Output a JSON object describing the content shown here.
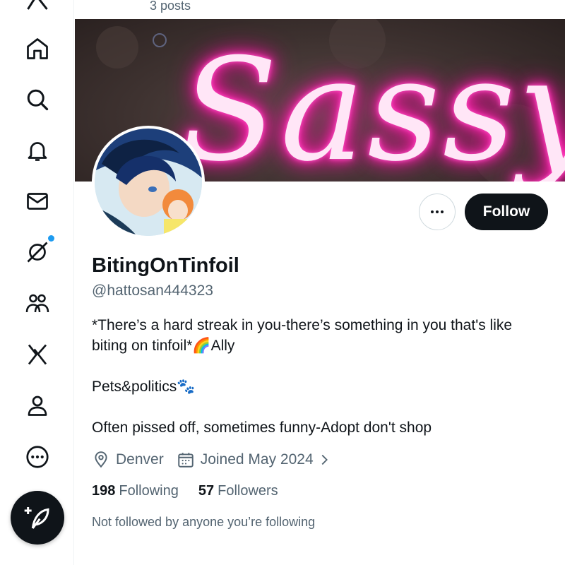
{
  "header": {
    "post_count": "3 posts"
  },
  "profile": {
    "display_name": "BitingOnTinfoil",
    "handle": "@hattosan444323",
    "bio": {
      "line1": "*There’s a hard streak in you-there’s something in you that's like biting on tinfoil*🌈Ally",
      "line2": "Pets&politics🐾",
      "line3": "Often pissed off, sometimes funny-Adopt don't shop"
    },
    "location": "Denver",
    "joined": "Joined May 2024",
    "following_count": "198",
    "following_label": "Following",
    "followers_count": "57",
    "followers_label": "Followers",
    "not_followed_note": "Not followed by anyone you’re following"
  },
  "banner": {
    "text": "Sassy"
  },
  "buttons": {
    "follow": "Follow"
  },
  "sidebar": {
    "icons": [
      "x-logo-icon",
      "home-icon",
      "search-icon",
      "bell-icon",
      "mail-icon",
      "grok-icon",
      "communities-icon",
      "x-premium-icon",
      "profile-icon",
      "more-icon",
      "compose-icon"
    ]
  },
  "colors": {
    "accent": "#1d9bf0",
    "text": "#0f1419",
    "muted": "#536471",
    "neon": "#ff2fb5"
  }
}
